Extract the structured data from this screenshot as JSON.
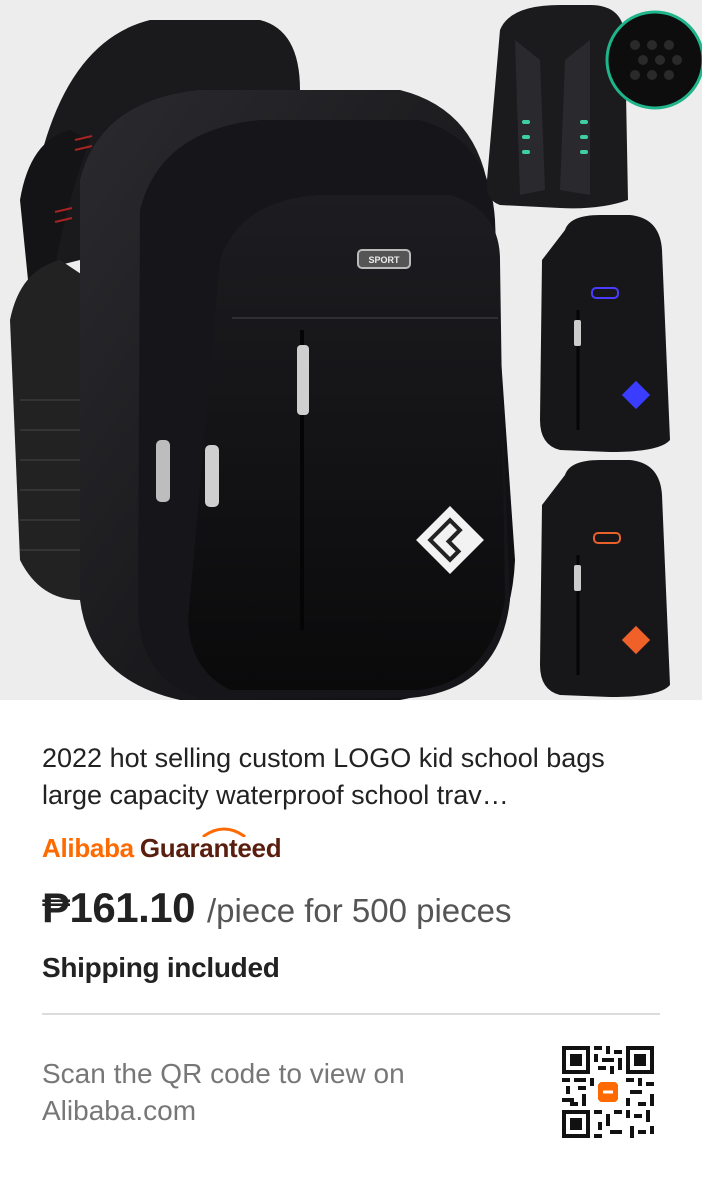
{
  "product": {
    "title": "2022 hot selling custom LOGO kid school bags large capacity waterproof school trav…",
    "image_icon": "backpack-product-photo",
    "logo_text": "SPORT"
  },
  "badge": {
    "alibaba": "Alibaba",
    "guaranteed": "Guaranteed",
    "colors": {
      "alibaba": "#ff6a00",
      "guaranteed": "#5a1e0e"
    }
  },
  "pricing": {
    "price": "₱161.10",
    "unit": "/piece for 500 pieces"
  },
  "shipping": "Shipping included",
  "scan": {
    "text": "Scan the QR code to view on Alibaba.com",
    "qr_icon": "qr-code-icon",
    "accent": "#ff6a00"
  }
}
